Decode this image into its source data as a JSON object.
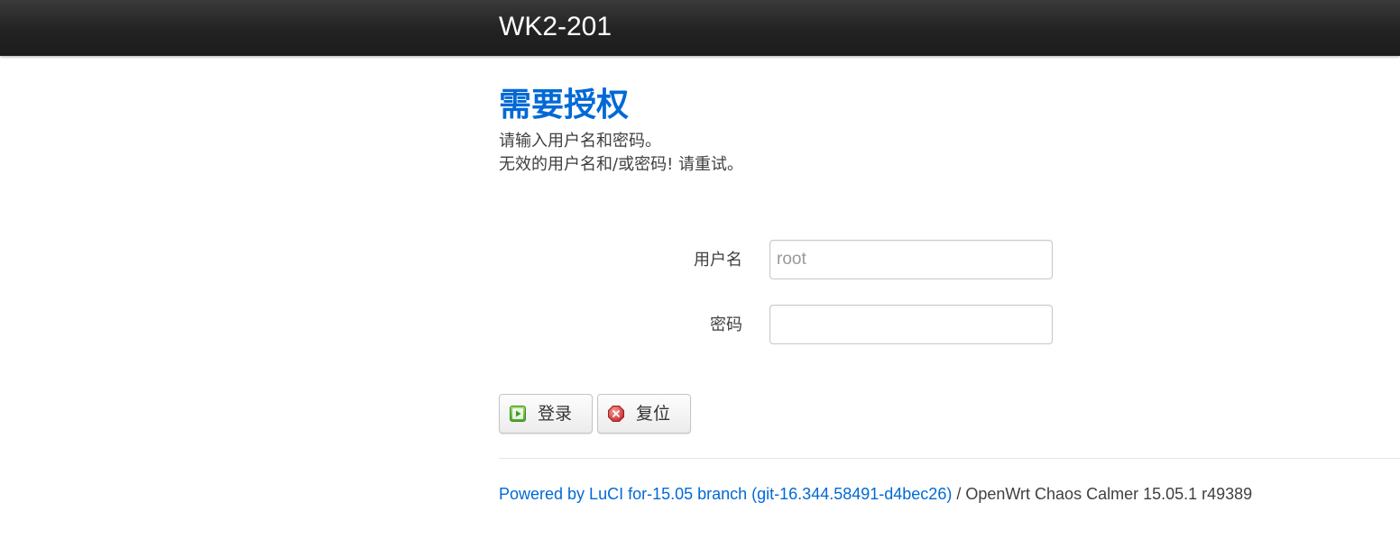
{
  "header": {
    "brand": "WK2-201"
  },
  "auth": {
    "title": "需要授权",
    "prompt": "请输入用户名和密码。",
    "error": "无效的用户名和/或密码! 请重试。"
  },
  "form": {
    "username_label": "用户名",
    "username_value": "",
    "username_placeholder": "root",
    "password_label": "密码",
    "password_value": ""
  },
  "buttons": {
    "login_label": "登录",
    "login_icon": "apply-icon",
    "reset_label": "复位",
    "reset_icon": "reset-icon"
  },
  "footer": {
    "link_text": "Powered by LuCI for-15.05 branch (git-16.344.58491-d4bec26)",
    "separator": " / ",
    "version": "OpenWrt Chaos Calmer 15.05.1 r49389"
  },
  "colors": {
    "accent": "#0069d6",
    "header_bg": "#222222"
  }
}
